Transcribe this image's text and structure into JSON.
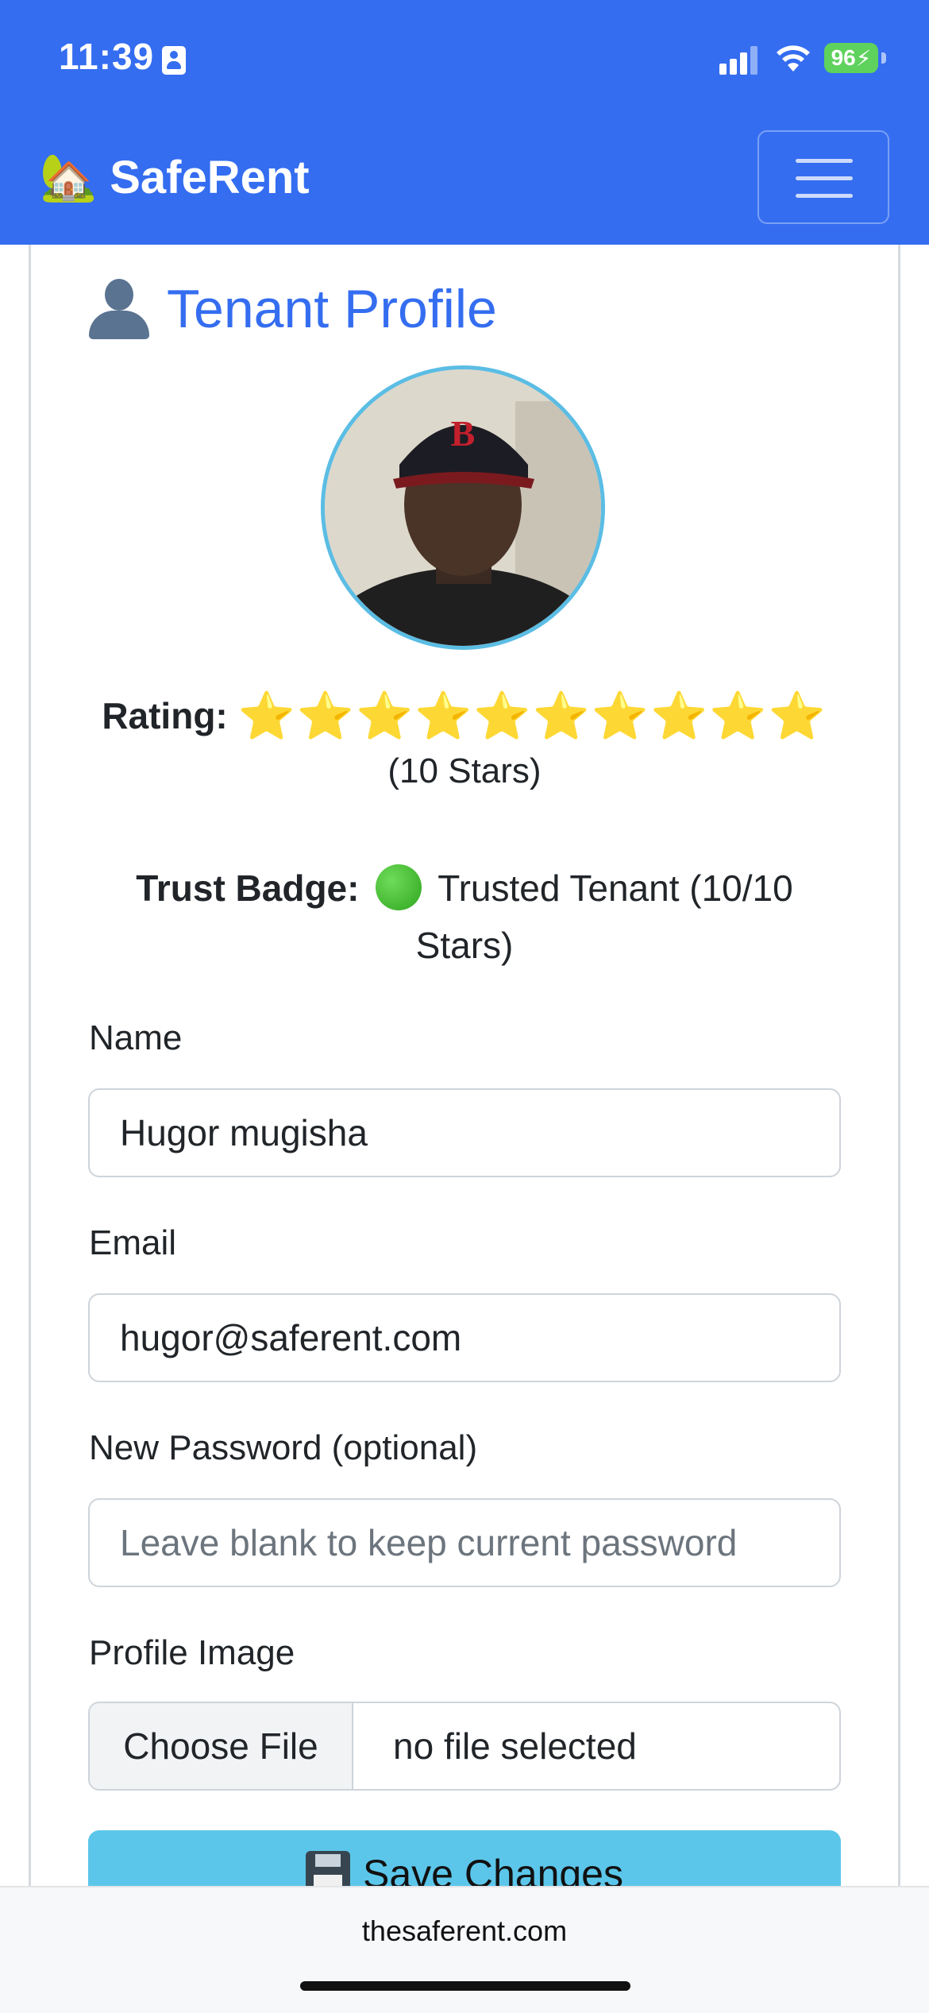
{
  "status_bar": {
    "time": "11:39",
    "battery": "96"
  },
  "navbar": {
    "brand_icon": "🏡",
    "brand": "SafeRent",
    "menu_icon": "hamburger-icon"
  },
  "profile": {
    "title_icon": "person-silhouette-icon",
    "title": "Tenant Profile",
    "rating_label": "Rating:",
    "rating_value": 10,
    "stars_text": "⭐⭐⭐⭐⭐⭐⭐⭐⭐⭐",
    "rating_count": "(10 Stars)",
    "trust_label": "Trust Badge:",
    "trust_text": "Trusted Tenant (10/10 Stars)"
  },
  "form": {
    "name_label": "Name",
    "name_value": "Hugor mugisha",
    "email_label": "Email",
    "email_value": "hugor@saferent.com",
    "password_label": "New Password (optional)",
    "password_placeholder": "Leave blank to keep current password",
    "image_label": "Profile Image",
    "file_button": "Choose File",
    "file_status": "no file selected",
    "save_label": "Save Changes"
  },
  "browser": {
    "url": "thesaferent.com"
  }
}
